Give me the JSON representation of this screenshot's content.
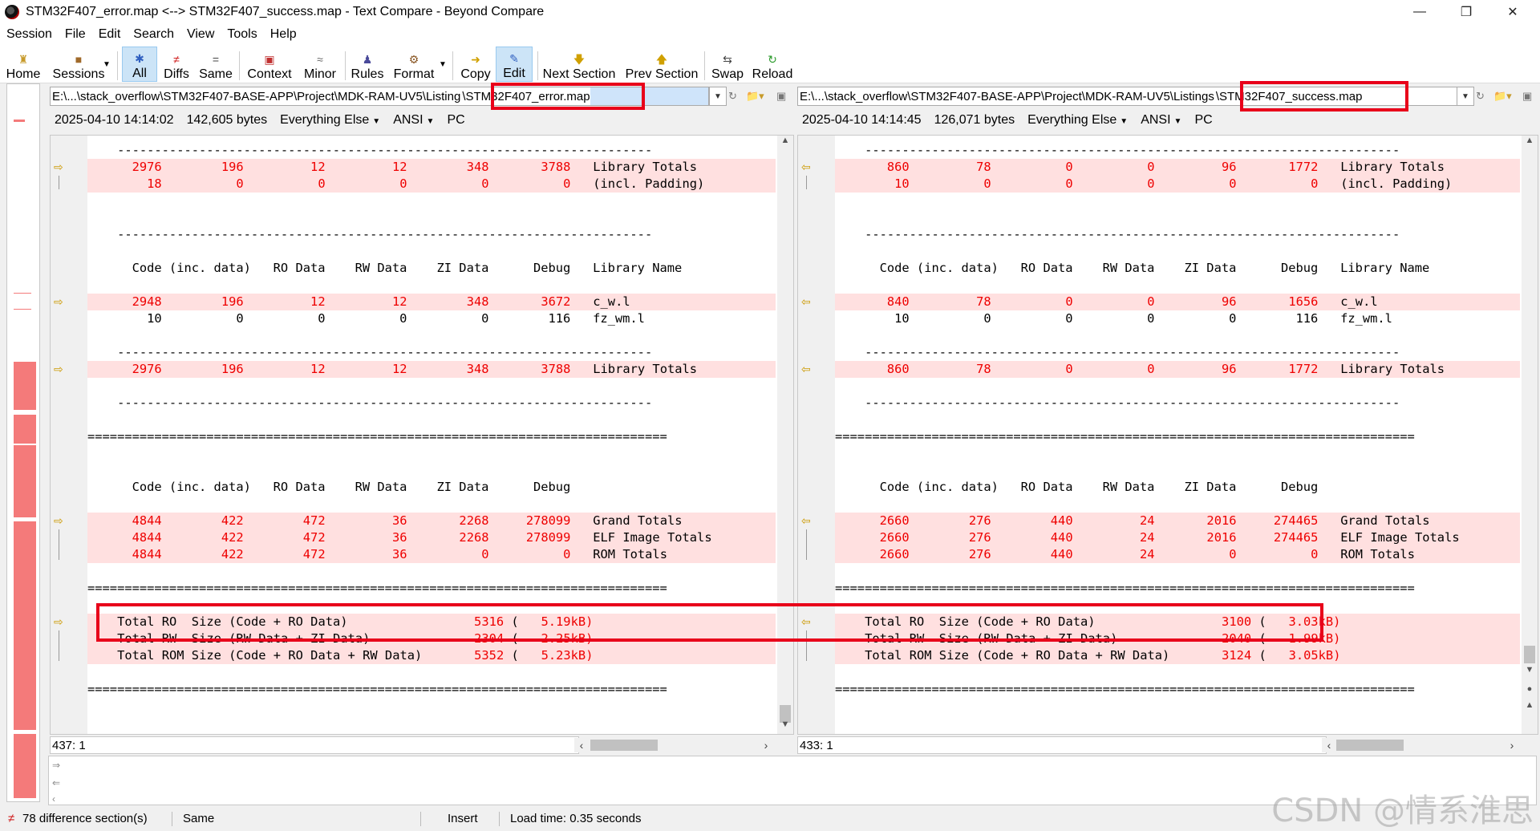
{
  "window": {
    "title": "STM32F407_error.map <--> STM32F407_success.map - Text Compare - Beyond Compare",
    "min_icon": "minimize-icon",
    "max_icon": "restore-icon",
    "close_icon": "close-icon"
  },
  "menu": [
    "Session",
    "File",
    "Edit",
    "Search",
    "View",
    "Tools",
    "Help"
  ],
  "toolbar": {
    "home": "Home",
    "sessions": "Sessions",
    "all": "All",
    "diffs": "Diffs",
    "same": "Same",
    "context": "Context",
    "minor": "Minor",
    "rules": "Rules",
    "format": "Format",
    "copy": "Copy",
    "edit": "Edit",
    "next_section": "Next Section",
    "prev_section": "Prev Section",
    "swap": "Swap",
    "reload": "Reload"
  },
  "left": {
    "path_prefix": "E:\\...\\stack_overflow\\STM32F407-BASE-APP\\Project\\MDK-RAM-UV5\\Listing",
    "path_file": "\\STM32F407_error.map",
    "date": "2025-04-10 14:14:02",
    "size": "142,605 bytes",
    "filter": "Everything Else",
    "encoding": "ANSI",
    "lineend": "PC",
    "position": "437: 1"
  },
  "right": {
    "path_prefix": "E:\\...\\stack_overflow\\STM32F407-BASE-APP\\Project\\MDK-RAM-UV5\\Listings",
    "path_file": "\\STM32F407_success.map",
    "date": "2025-04-10 14:14:45",
    "size": "126,071 bytes",
    "filter": "Everything Else",
    "encoding": "ANSI",
    "lineend": "PC",
    "position": "433: 1"
  },
  "left_lines": [
    {
      "t": "    ------------------------------------------------------------------------",
      "d": false
    },
    {
      "t": "      2976        196         12         12        348       3788   Library Totals",
      "d": true
    },
    {
      "t": "        18          0          0          0          0          0   (incl. Padding)",
      "d": true
    },
    {
      "t": "",
      "d": false
    },
    {
      "t": "",
      "d": false
    },
    {
      "t": "    ------------------------------------------------------------------------",
      "d": false
    },
    {
      "t": "",
      "d": false
    },
    {
      "t": "      Code (inc. data)   RO Data    RW Data    ZI Data      Debug   Library Name",
      "d": false
    },
    {
      "t": "",
      "d": false
    },
    {
      "t": "      2948        196         12         12        348       3672   c_w.l",
      "d": true
    },
    {
      "t": "        10          0          0          0          0        116   fz_wm.l",
      "d": false
    },
    {
      "t": "",
      "d": false
    },
    {
      "t": "    ------------------------------------------------------------------------",
      "d": false
    },
    {
      "t": "      2976        196         12         12        348       3788   Library Totals",
      "d": true
    },
    {
      "t": "",
      "d": false
    },
    {
      "t": "    ------------------------------------------------------------------------",
      "d": false
    },
    {
      "t": "",
      "d": false
    },
    {
      "t": "==============================================================================",
      "d": false
    },
    {
      "t": "",
      "d": false
    },
    {
      "t": "",
      "d": false
    },
    {
      "t": "      Code (inc. data)   RO Data    RW Data    ZI Data      Debug",
      "d": false
    },
    {
      "t": "",
      "d": false
    },
    {
      "t": "      4844        422        472         36       2268     278099   Grand Totals",
      "d": true
    },
    {
      "t": "      4844        422        472         36       2268     278099   ELF Image Totals",
      "d": true
    },
    {
      "t": "      4844        422        472         36          0          0   ROM Totals",
      "d": true
    },
    {
      "t": "",
      "d": false
    },
    {
      "t": "==============================================================================",
      "d": false
    },
    {
      "t": "",
      "d": false
    },
    {
      "t": "    Total RO  Size (Code + RO Data)                 5316 (   5.19kB)",
      "d": true
    },
    {
      "t": "    Total RW  Size (RW Data + ZI Data)              2304 (   2.25kB)",
      "d": true
    },
    {
      "t": "    Total ROM Size (Code + RO Data + RW Data)       5352 (   5.23kB)",
      "d": true
    },
    {
      "t": "",
      "d": false
    },
    {
      "t": "==============================================================================",
      "d": false
    }
  ],
  "right_lines": [
    {
      "t": "    ------------------------------------------------------------------------",
      "d": false
    },
    {
      "t": "       860         78          0          0         96       1772   Library Totals",
      "d": true
    },
    {
      "t": "        10          0          0          0          0          0   (incl. Padding)",
      "d": true
    },
    {
      "t": "",
      "d": false
    },
    {
      "t": "",
      "d": false
    },
    {
      "t": "    ------------------------------------------------------------------------",
      "d": false
    },
    {
      "t": "",
      "d": false
    },
    {
      "t": "      Code (inc. data)   RO Data    RW Data    ZI Data      Debug   Library Name",
      "d": false
    },
    {
      "t": "",
      "d": false
    },
    {
      "t": "       840         78          0          0         96       1656   c_w.l",
      "d": true
    },
    {
      "t": "        10          0          0          0          0        116   fz_wm.l",
      "d": false
    },
    {
      "t": "",
      "d": false
    },
    {
      "t": "    ------------------------------------------------------------------------",
      "d": false
    },
    {
      "t": "       860         78          0          0         96       1772   Library Totals",
      "d": true
    },
    {
      "t": "",
      "d": false
    },
    {
      "t": "    ------------------------------------------------------------------------",
      "d": false
    },
    {
      "t": "",
      "d": false
    },
    {
      "t": "==============================================================================",
      "d": false
    },
    {
      "t": "",
      "d": false
    },
    {
      "t": "",
      "d": false
    },
    {
      "t": "      Code (inc. data)   RO Data    RW Data    ZI Data      Debug",
      "d": false
    },
    {
      "t": "",
      "d": false
    },
    {
      "t": "      2660        276        440         24       2016     274465   Grand Totals",
      "d": true
    },
    {
      "t": "      2660        276        440         24       2016     274465   ELF Image Totals",
      "d": true
    },
    {
      "t": "      2660        276        440         24          0          0   ROM Totals",
      "d": true
    },
    {
      "t": "",
      "d": false
    },
    {
      "t": "==============================================================================",
      "d": false
    },
    {
      "t": "",
      "d": false
    },
    {
      "t": "    Total RO  Size (Code + RO Data)                 3100 (   3.03kB)",
      "d": true
    },
    {
      "t": "    Total RW  Size (RW Data + ZI Data)              2040 (   1.99kB)",
      "d": true
    },
    {
      "t": "    Total ROM Size (Code + RO Data + RW Data)       3124 (   3.05kB)",
      "d": true
    },
    {
      "t": "",
      "d": false
    },
    {
      "t": "==============================================================================",
      "d": false
    }
  ],
  "status": {
    "diff_count": "78 difference section(s)",
    "same": "Same",
    "insert": "Insert",
    "load_time": "Load time: 0.35 seconds"
  },
  "watermark": "CSDN @情系淮思",
  "colors": {
    "diff_bg": "#ffe0e0",
    "diff_text": "#e00000",
    "highlight": "#e8001a",
    "overview": "#f47a7a"
  }
}
